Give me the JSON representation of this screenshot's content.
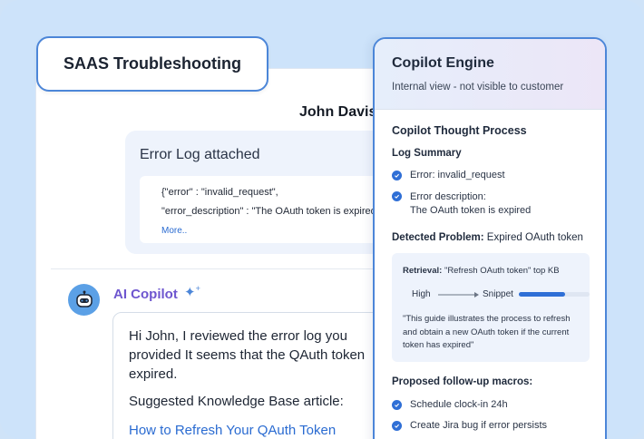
{
  "header": {
    "title": "SAAS Troubleshooting"
  },
  "chat": {
    "user_name": "John Davis",
    "log": {
      "title": "Error Log attached",
      "line1": "{\"error\" : \"invalid_request\",",
      "line2": "\"error_description\" : \"The OAuth token is expired.",
      "more": "More.."
    },
    "copilot": {
      "name": "AI Copilot",
      "reply": "Hi John, I reviewed the error log you provided  It seems that the QAuth token expired.",
      "kb_label": "Suggested Knowledge Base article:",
      "kb_link": "How to Refresh Your QAuth Token"
    }
  },
  "engine": {
    "title": "Copilot Engine",
    "subtitle": "Internal view - not visible to customer",
    "thought_title": "Copilot Thought Process",
    "log_summary_title": "Log Summary",
    "summary": [
      {
        "label": "Error:",
        "value": " invalid_request"
      },
      {
        "label": "Error description:",
        "value": "The OAuth token is expired"
      }
    ],
    "detected_label": "Detected Problem:",
    "detected_value": " Expired OAuth token",
    "retrieval": {
      "label": "Retrieval:",
      "value": " \"Refresh OAuth token\" top KB",
      "from": "High",
      "to": "Snippet",
      "confidence": 0.65,
      "quote": "\"This guide illustrates the process to refresh and obtain a new OAuth token if the current token has expired\""
    },
    "macros_title": "Proposed follow-up macros:",
    "macros": [
      "Schedule clock-in 24h",
      "Create Jira bug if error persists"
    ]
  },
  "colors": {
    "accent": "#2f6fd6",
    "copilot": "#6e56cf",
    "background": "#cde3fa"
  }
}
